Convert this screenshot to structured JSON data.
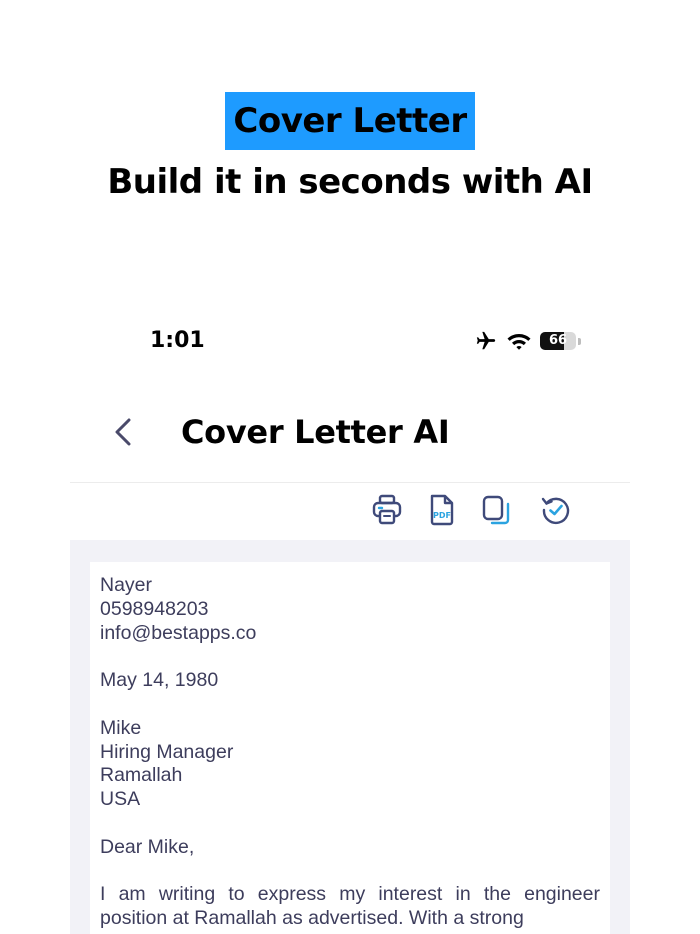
{
  "promo": {
    "title": "Cover Letter",
    "subtitle": "Build it in seconds with AI",
    "accent_color": "#1e9bff"
  },
  "status_bar": {
    "time": "1:01",
    "icons": [
      "airplane-icon",
      "wifi-icon",
      "battery-icon"
    ],
    "battery_level": "66",
    "battery_fraction": 0.66
  },
  "nav": {
    "back_icon": "chevron-left-icon",
    "title": "Cover Letter AI"
  },
  "toolbar": {
    "icons": [
      "print-icon",
      "pdf-icon",
      "copy-icon",
      "history-icon"
    ],
    "pdf_label": "PDF",
    "icon_color": "#3f4a7a",
    "accent_color": "#2ba3e0"
  },
  "letter": {
    "name": "Nayer",
    "phone": "0598948203",
    "email": "info@bestapps.co",
    "date": "May 14, 1980",
    "recipient_name": "Mike",
    "recipient_title": "Hiring Manager",
    "city": "Ramallah",
    "country": "USA",
    "salutation": "Dear Mike,",
    "body": "I am writing to express my interest in the engineer position at Ramallah as advertised. With a strong"
  }
}
